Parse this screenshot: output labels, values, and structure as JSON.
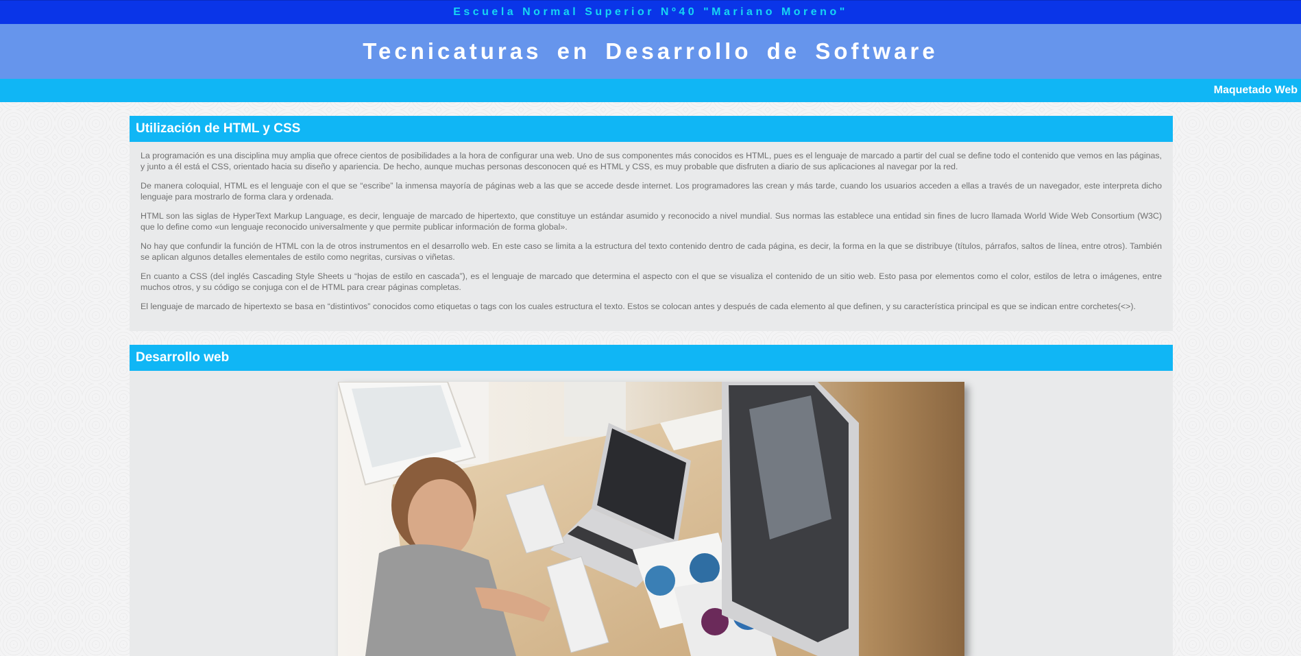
{
  "header": {
    "school": "Escuela Normal Superior Nº40 \"Mariano Moreno\"",
    "title": "Tecnicaturas en Desarrollo de Software"
  },
  "nav": {
    "link": "Maquetado Web"
  },
  "sections": [
    {
      "title": "Utilización de HTML y CSS",
      "paragraphs": [
        "La programación es una disciplina muy amplia que ofrece cientos de posibilidades a la hora de configurar una web. Uno de sus componentes más conocidos es HTML, pues es el lenguaje de marcado a partir del cual se define todo el contenido que vemos en las páginas, y junto a él está el CSS, orientado hacia su diseño y apariencia. De hecho, aunque muchas personas desconocen qué es HTML y CSS, es muy probable que disfruten a diario de sus aplicaciones al navegar por la red.",
        "De manera coloquial, HTML es el lenguaje con el que se “escribe” la inmensa mayoría de páginas web a las que se accede desde internet. Los programadores las crean y más tarde, cuando los usuarios acceden a ellas a través de un navegador, este interpreta dicho lenguaje para mostrarlo de forma clara y ordenada.",
        "HTML son las siglas de HyperText Markup Language, es decir, lenguaje de marcado de hipertexto, que constituye un estándar asumido y reconocido a nivel mundial. Sus normas las establece una entidad sin fines de lucro llamada World Wide Web Consortium (W3C) que lo define como «un lenguaje reconocido universalmente y que permite publicar información de forma global».",
        "No hay que confundir la función de HTML con la de otros instrumentos en el desarrollo web. En este caso se limita a la estructura del texto contenido dentro de cada página, es decir, la forma en la que se distribuye (títulos, párrafos, saltos de línea, entre otros). También se aplican algunos detalles elementales de estilo como negritas, cursivas o viñetas.",
        "En cuanto a CSS (del inglés Cascading Style Sheets u “hojas de estilo en cascada”), es el lenguaje de marcado que determina el aspecto con el que se visualiza el contenido de un sitio web. Esto pasa por elementos como el color, estilos de letra o imágenes, entre muchos otros, y su código se conjuga con el de HTML para crear páginas completas.",
        "El lenguaje de marcado de hipertexto se basa en “distintivos” conocidos como etiquetas o tags con los cuales estructura el texto. Estos se colocan antes y después de cada elemento al que definen, y su característica principal es que se indican entre corchetes(<>)."
      ]
    },
    {
      "title": "Desarrollo web",
      "image_icon": "photo-developer-at-desk"
    }
  ],
  "colors": {
    "top_bar": "#0a35e8",
    "top_bar_text": "#16d6f2",
    "hero": "#6695ec",
    "accent": "#10b6f5",
    "section_bg": "#e9eaeb",
    "body_text": "#6f6f6f"
  }
}
